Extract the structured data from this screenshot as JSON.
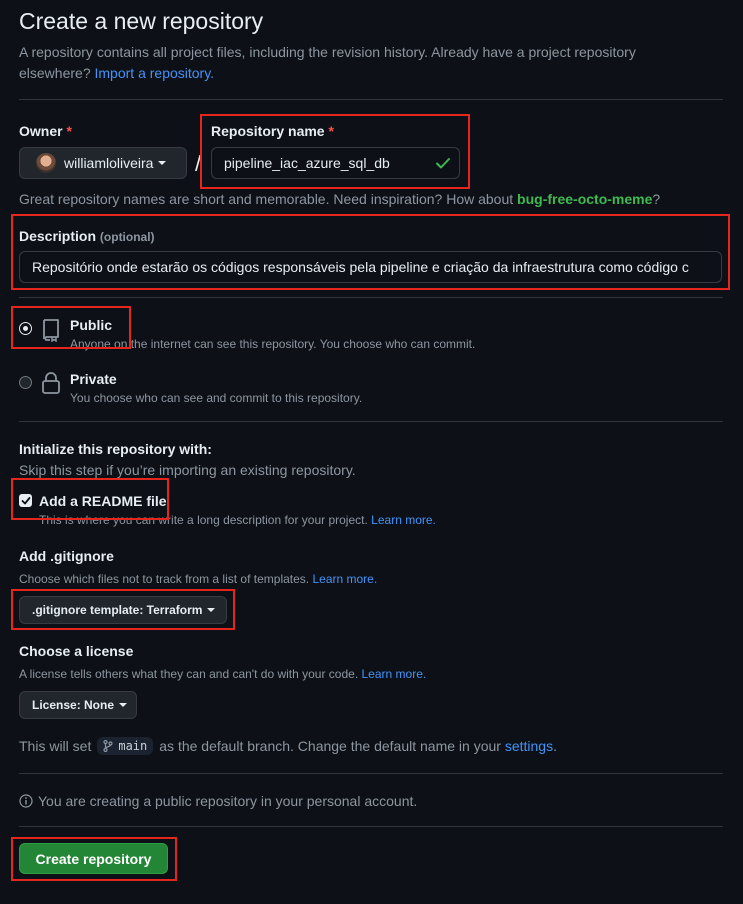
{
  "header": {
    "title": "Create a new repository",
    "intro_text": "A repository contains all project files, including the revision history. Already have a project repository",
    "intro_text_2": "elsewhere?",
    "import_link": "Import a repository."
  },
  "owner": {
    "label": "Owner",
    "required": "*",
    "value": "williamloliveira"
  },
  "separator": "/",
  "repo_name": {
    "label": "Repository name",
    "required": "*",
    "value": "pipeline_iac_azure_sql_db"
  },
  "name_hint": {
    "text": "Great repository names are short and memorable. Need inspiration? How about",
    "suggestion": "bug-free-octo-meme",
    "end": "?"
  },
  "description": {
    "label": "Description",
    "optional": "(optional)",
    "value": "Repositório onde estarão os códigos responsáveis pela pipeline e criação da infraestrutura como código c"
  },
  "visibility": {
    "public_label": "Public",
    "public_desc": "Anyone on the internet can see this repository. You choose who can commit.",
    "private_label": "Private",
    "private_desc": "You choose who can see and commit to this repository.",
    "selected": "public"
  },
  "init": {
    "heading": "Initialize this repository with:",
    "subtext": "Skip this step if you’re importing an existing repository.",
    "readme_label": "Add a README file",
    "readme_checked": true,
    "readme_desc": "This is where you can write a long description for your project.",
    "readme_link": "Learn more."
  },
  "gitignore": {
    "heading": "Add .gitignore",
    "desc": "Choose which files not to track from a list of templates.",
    "link": "Learn more.",
    "button": ".gitignore template: Terraform"
  },
  "license": {
    "heading": "Choose a license",
    "desc": "A license tells others what they can and can't do with your code.",
    "link": "Learn more.",
    "button": "License: None"
  },
  "branch": {
    "prefix": "This will set",
    "branch_name": "main",
    "middle": "as the default branch. Change the default name in your",
    "link": "settings",
    "end": "."
  },
  "notice": {
    "text": "You are creating a public repository in your personal account."
  },
  "submit": {
    "label": "Create repository"
  },
  "colors": {
    "background": "#0d1117",
    "accent_link": "#4493f8",
    "primary_button": "#238636",
    "annotation_box": "#e5261d"
  }
}
